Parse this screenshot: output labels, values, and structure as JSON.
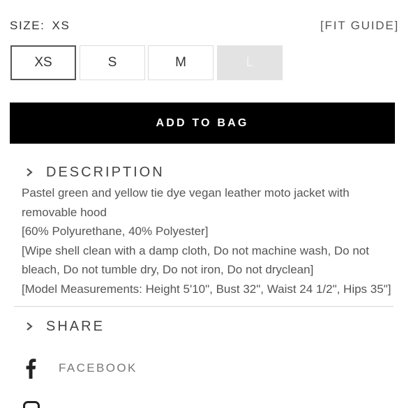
{
  "size_selector": {
    "label": "SIZE:",
    "selected_value": "XS",
    "fit_guide": "[FIT GUIDE]",
    "options": [
      {
        "label": "XS",
        "state": "selected"
      },
      {
        "label": "S",
        "state": "available"
      },
      {
        "label": "M",
        "state": "available"
      },
      {
        "label": "L",
        "state": "unavailable"
      }
    ]
  },
  "add_to_bag": "ADD TO BAG",
  "description": {
    "title": "DESCRIPTION",
    "lines": [
      "Pastel green and yellow tie dye vegan leather moto jacket with",
      "removable hood",
      "[60% Polyurethane, 40% Polyester]",
      "[Wipe shell clean with a damp cloth, Do not machine wash, Do not",
      "bleach, Do not tumble dry, Do not iron, Do not dryclean]",
      "[Model Measurements: Height 5'10\", Bust 32\", Waist 24 1/2\", Hips 35\"]"
    ]
  },
  "share": {
    "title": "SHARE",
    "facebook": "FACEBOOK",
    "icons": [
      "facebook-icon",
      "instagram-icon"
    ]
  },
  "colors": {
    "button_bg": "#000000",
    "button_text": "#ffffff",
    "disabled_bg": "#e3e3e3",
    "text": "#333333"
  }
}
